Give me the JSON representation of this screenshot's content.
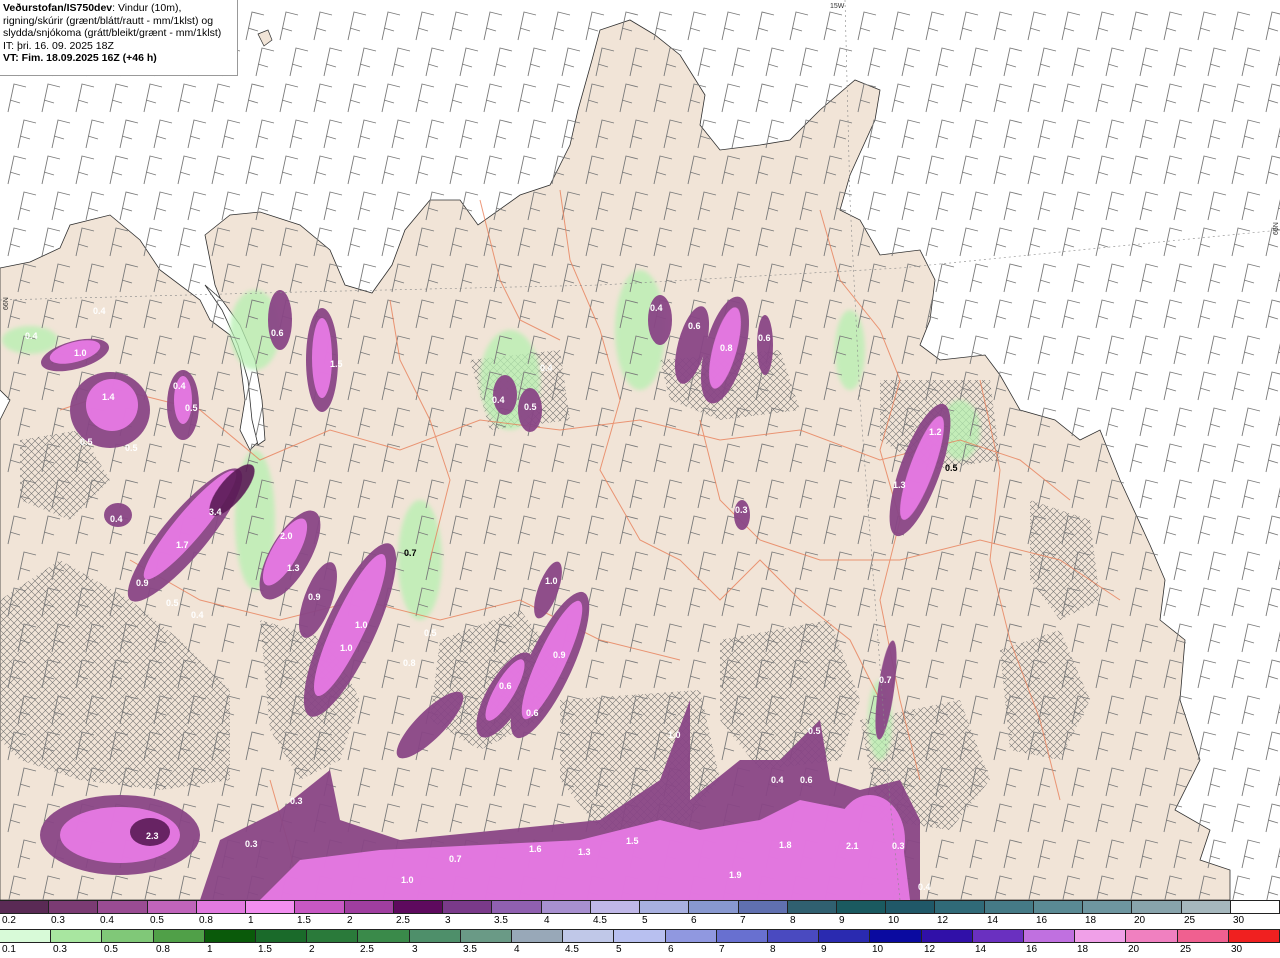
{
  "header": {
    "org": "Veðurstofan/IS750dev",
    "desc1": ": Vindur (10m),",
    "desc2": "rigning/skúrir (grænt/blátt/rautt - mm/1klst) og",
    "desc3": "slydda/snjókoma (grátt/bleikt/grænt - mm/1klst)",
    "it": "IT: þri. 16. 09. 2025 18Z",
    "vt": "VT: Fim. 18.09.2025 16Z (+46 h)"
  },
  "map_labels": {
    "lon_15w": "15W",
    "lat_66n_left": "66N",
    "lat_66n_right": "66N"
  },
  "precip_values": [
    {
      "id": "v1",
      "text": "0.4"
    },
    {
      "id": "v2",
      "text": "1.0"
    },
    {
      "id": "v3",
      "text": "0.4"
    },
    {
      "id": "v4",
      "text": "1.4"
    },
    {
      "id": "v5",
      "text": "0.4"
    },
    {
      "id": "v6",
      "text": "0.5"
    },
    {
      "id": "v7",
      "text": "0.5"
    },
    {
      "id": "v8",
      "text": "0.5"
    },
    {
      "id": "v9",
      "text": "0.4"
    },
    {
      "id": "v10",
      "text": "3.4"
    },
    {
      "id": "v11",
      "text": "1.7"
    },
    {
      "id": "v12",
      "text": "0.9"
    },
    {
      "id": "v13",
      "text": "0.5"
    },
    {
      "id": "v14",
      "text": "0.4"
    },
    {
      "id": "v15",
      "text": "0.6"
    },
    {
      "id": "v16",
      "text": "1.5"
    },
    {
      "id": "v17",
      "text": "2.0"
    },
    {
      "id": "v18",
      "text": "1.3"
    },
    {
      "id": "v19",
      "text": "0.9"
    },
    {
      "id": "v20",
      "text": "1.0"
    },
    {
      "id": "v21",
      "text": "1.0"
    },
    {
      "id": "v22",
      "text": "0.7"
    },
    {
      "id": "v23",
      "text": "0.4"
    },
    {
      "id": "v24",
      "text": "0.5"
    },
    {
      "id": "v25",
      "text": "0.4"
    },
    {
      "id": "v26",
      "text": "0.5"
    },
    {
      "id": "v27",
      "text": "0.8"
    },
    {
      "id": "v28",
      "text": "0.6"
    },
    {
      "id": "v29",
      "text": "1.0"
    },
    {
      "id": "v30",
      "text": "0.9"
    },
    {
      "id": "v31",
      "text": "0.6"
    },
    {
      "id": "v32",
      "text": "0.6"
    },
    {
      "id": "v33",
      "text": "0.4"
    },
    {
      "id": "v34",
      "text": "1.2"
    },
    {
      "id": "v35",
      "text": "1.3"
    },
    {
      "id": "v36",
      "text": "0.5"
    },
    {
      "id": "v37",
      "text": "0.3"
    },
    {
      "id": "v38",
      "text": "0.7"
    },
    {
      "id": "v39",
      "text": "1.0"
    },
    {
      "id": "v40",
      "text": "0.8"
    },
    {
      "id": "v41",
      "text": "0.6"
    },
    {
      "id": "v42",
      "text": "2.3"
    },
    {
      "id": "v43",
      "text": "0.3"
    },
    {
      "id": "v44",
      "text": "0.3"
    },
    {
      "id": "v45",
      "text": "1.6"
    },
    {
      "id": "v46",
      "text": "1.3"
    },
    {
      "id": "v47",
      "text": "1.5"
    },
    {
      "id": "v48",
      "text": "1.9"
    },
    {
      "id": "v49",
      "text": "1.8"
    },
    {
      "id": "v50",
      "text": "2.1"
    },
    {
      "id": "v51",
      "text": "0.3"
    },
    {
      "id": "v52",
      "text": "1.0"
    },
    {
      "id": "v53",
      "text": "0.7"
    },
    {
      "id": "v54",
      "text": "0.4"
    },
    {
      "id": "v55",
      "text": "0.6"
    },
    {
      "id": "v56",
      "text": "0.5"
    },
    {
      "id": "v57",
      "text": "0.4"
    }
  ],
  "legend_snow": {
    "labels": [
      "0.2",
      "0.3",
      "0.4",
      "0.5",
      "0.8",
      "1",
      "1.5",
      "2",
      "2.5",
      "3",
      "3.5",
      "4",
      "4.5",
      "5",
      "6",
      "7",
      "8",
      "9",
      "10",
      "12",
      "14",
      "16",
      "18",
      "20",
      "25",
      "30"
    ],
    "colors": [
      "#5a2a55",
      "#7b3b73",
      "#9a4c93",
      "#c064bb",
      "#e27ae0",
      "#f28ef0",
      "#c858c4",
      "#a03ea0",
      "#5e0a5e",
      "#7a3a8a",
      "#9060b0",
      "#a890d0",
      "#c0b8e8",
      "#a8b0e0",
      "#8898d0",
      "#6070b0",
      "#306070",
      "#1a5a60",
      "#205868",
      "#306a78",
      "#457a86",
      "#5a8a94",
      "#6e96a0",
      "#88a4ac",
      "#a6b8be",
      "#ffffff"
    ]
  },
  "legend_rain": {
    "labels": [
      "0.1",
      "0.3",
      "0.5",
      "0.8",
      "1",
      "1.5",
      "2",
      "2.5",
      "3",
      "3.5",
      "4",
      "4.5",
      "5",
      "6",
      "7",
      "8",
      "9",
      "10",
      "12",
      "14",
      "16",
      "18",
      "20",
      "25",
      "30"
    ],
    "colors": [
      "#d8fad8",
      "#a8e6a0",
      "#80c878",
      "#50a048",
      "#0a5a0a",
      "#1a6a2a",
      "#2a7a3a",
      "#3a8a4a",
      "#4e8f6a",
      "#6a9a86",
      "#98a8b8",
      "#c0c8e8",
      "#b8c0f0",
      "#9098e0",
      "#6870d0",
      "#4a4ac0",
      "#2a2ab0",
      "#0a0aa0",
      "#3010a8",
      "#6a30c0",
      "#c070e0",
      "#f0a0e8",
      "#f080c0",
      "#f06090",
      "#f02020"
    ]
  }
}
